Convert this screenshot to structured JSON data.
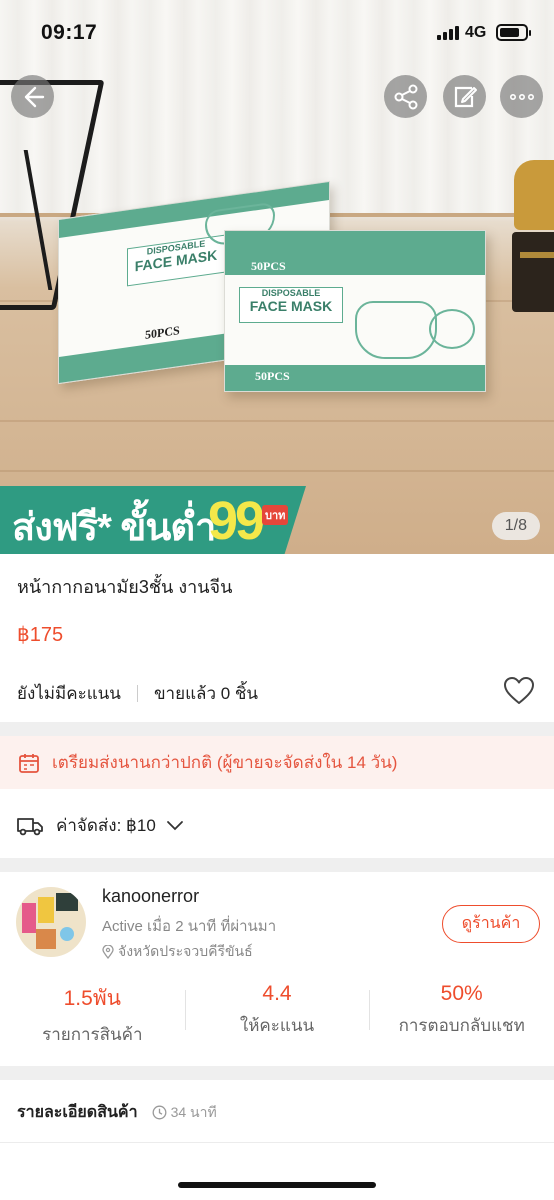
{
  "status_bar": {
    "time": "09:17",
    "network": "4G"
  },
  "hero": {
    "promo_text": "ส่งฟรี* ขั้นต่ำ",
    "promo_amount": "99",
    "promo_unit": "บาท",
    "page_counter": "1/8",
    "box_front": {
      "label_top": "DISPOSABLE",
      "label_main": "FACE MASK",
      "pcs": "50PCS"
    },
    "box_back": {
      "label_top": "DISPOSABLE",
      "label_main": "FACE MASK",
      "pcs": "50PCS"
    }
  },
  "icons": {
    "back": "back-arrow-icon",
    "share": "share-icon",
    "edit": "edit-icon",
    "more": "more-icon",
    "heart": "heart-icon",
    "calendar": "calendar-icon",
    "truck": "truck-icon",
    "location": "location-pin-icon",
    "clock": "clock-icon"
  },
  "product": {
    "title": "หน้ากากอนามัย3ชั้น งานจีน",
    "price": "฿175",
    "rating_text": "ยังไม่มีคะแนน",
    "sold_text": "ขายแล้ว 0 ชิ้น"
  },
  "notice": {
    "text": "เตรียมส่งนานกว่าปกติ (ผู้ขายจะจัดส่งใน 14 วัน)"
  },
  "shipping": {
    "text": "ค่าจัดส่ง: ฿10"
  },
  "shop": {
    "name": "kanoonerror",
    "active": "Active เมื่อ 2 นาที ที่ผ่านมา",
    "location": "จังหวัดประจวบคีรีขันธ์",
    "view_button": "ดูร้านค้า",
    "stats": [
      {
        "value": "1.5พัน",
        "label": "รายการสินค้า"
      },
      {
        "value": "4.4",
        "label": "ให้คะแนน"
      },
      {
        "value": "50%",
        "label": "การตอบกลับแชท"
      }
    ]
  },
  "details": {
    "title": "รายละเอียดสินค้า",
    "time": "34 นาที"
  },
  "colors": {
    "accent": "#ee4d2d",
    "promo_green": "#2f9b82",
    "promo_yellow": "#f4e84a",
    "notice_bg": "#fdf1ee"
  }
}
